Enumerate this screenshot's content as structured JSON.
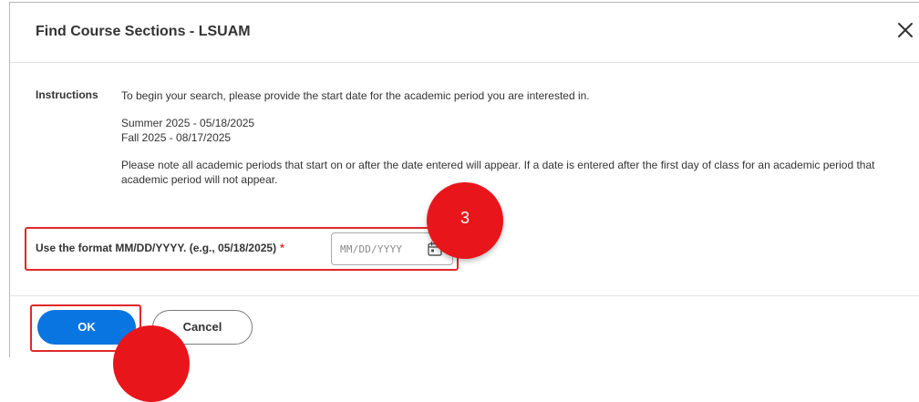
{
  "dialog": {
    "title": "Find Course Sections - LSUAM",
    "close_icon": "close-icon"
  },
  "instructions": {
    "label": "Instructions",
    "intro": "To begin your search, please provide the start date for the academic period you are interested in.",
    "periods": [
      "Summer 2025 - 05/18/2025",
      "Fall 2025 - 08/17/2025"
    ],
    "note": "Please note all academic periods that start on or after the date entered will appear. If a date is entered after the first day of class for an academic period that academic period will not appear."
  },
  "date_field": {
    "label": "Use the format MM/DD/YYYY. (e.g., 05/18/2025)",
    "required_marker": "*",
    "placeholder": "MM/DD/YYYY",
    "icon": "calendar-icon"
  },
  "annotations": {
    "step_3": "3"
  },
  "footer": {
    "ok_label": "OK",
    "cancel_label": "Cancel"
  },
  "colors": {
    "primary_button": "#0875e1",
    "highlight_border": "#e0282a",
    "step_badge": "#e8161b",
    "required": "#de2b2b"
  }
}
